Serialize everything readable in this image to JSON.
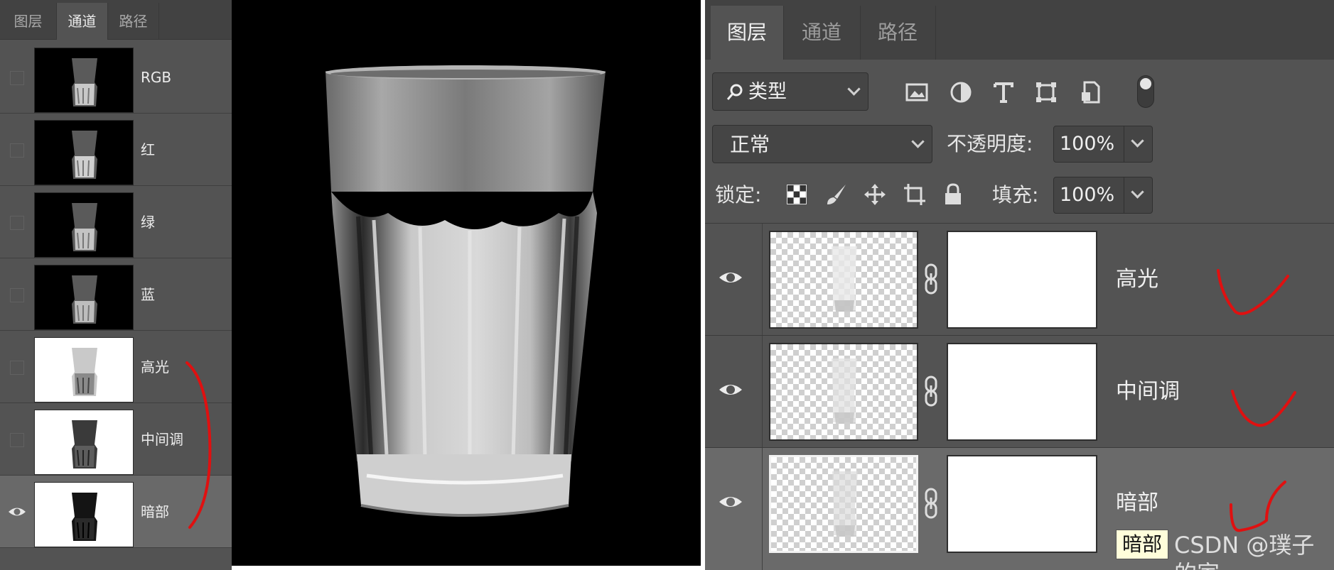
{
  "channels_panel": {
    "tabs": [
      "图层",
      "通道",
      "路径"
    ],
    "active_tab": "通道",
    "channels": [
      {
        "label": "RGB",
        "visible": false,
        "selected": false,
        "thumb": "dark"
      },
      {
        "label": "红",
        "visible": false,
        "selected": false,
        "thumb": "dark"
      },
      {
        "label": "绿",
        "visible": false,
        "selected": false,
        "thumb": "dark"
      },
      {
        "label": "蓝",
        "visible": false,
        "selected": false,
        "thumb": "dark"
      },
      {
        "label": "高光",
        "visible": false,
        "selected": false,
        "thumb": "light"
      },
      {
        "label": "中间调",
        "visible": false,
        "selected": false,
        "thumb": "light"
      },
      {
        "label": "暗部",
        "visible": true,
        "selected": true,
        "thumb": "light"
      }
    ]
  },
  "layers_panel": {
    "tabs": [
      "图层",
      "通道",
      "路径"
    ],
    "active_tab": "图层",
    "filter": {
      "label": "类型",
      "icon": "search-icon"
    },
    "filter_icons": [
      "image-filter-icon",
      "adjustment-filter-icon",
      "type-filter-icon",
      "shape-filter-icon",
      "smart-object-filter-icon"
    ],
    "blend_mode": "正常",
    "opacity_label": "不透明度:",
    "opacity_value": "100%",
    "lock_label": "锁定:",
    "lock_icons": [
      "lock-transparent-icon",
      "lock-paint-icon",
      "lock-position-icon",
      "lock-artboard-icon",
      "lock-all-icon"
    ],
    "fill_label": "填充:",
    "fill_value": "100%",
    "layers": [
      {
        "name": "高光",
        "visible": true,
        "selected": false
      },
      {
        "name": "中间调",
        "visible": true,
        "selected": false
      },
      {
        "name": "暗部",
        "visible": true,
        "selected": true
      }
    ],
    "tooltip": "暗部"
  },
  "watermark": "CSDN @璞子的家",
  "colors": {
    "panel_bg": "#535353",
    "tab_bg": "#424242",
    "annotation_red": "#e01010"
  }
}
